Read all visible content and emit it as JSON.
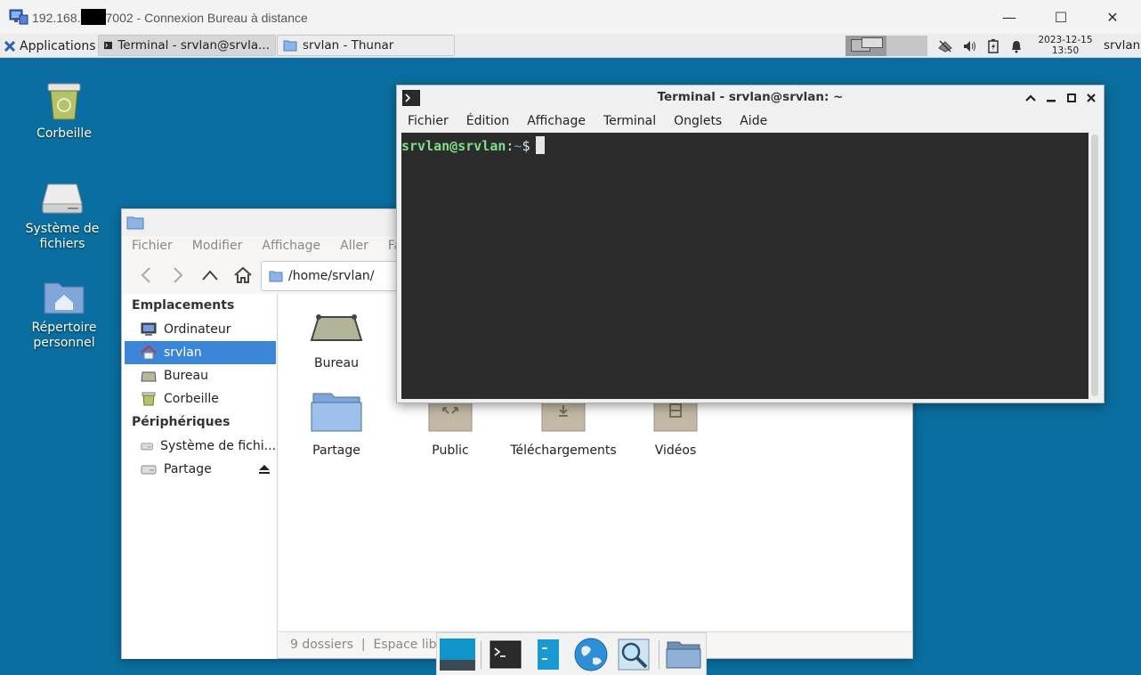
{
  "rdp": {
    "title_prefix": "192.168.",
    "title_suffix": "7002 - Connexion Bureau à distance",
    "minimize": "—",
    "maximize": "☐",
    "close": "✕"
  },
  "panel": {
    "applications": "Applications",
    "tasks": [
      {
        "label": "Terminal - srvlan@srvla...",
        "active": true
      },
      {
        "label": "srvlan - Thunar",
        "active": false
      }
    ],
    "clock_date": "2023-12-15",
    "clock_time": "13:50",
    "user": "srvlan"
  },
  "desktop": {
    "icons": [
      {
        "label": "Corbeille"
      },
      {
        "label": "Système de fichiers"
      },
      {
        "label": "Répertoire personnel"
      }
    ]
  },
  "thunar": {
    "menu": [
      "Fichier",
      "Modifier",
      "Affichage",
      "Aller",
      "Favoris"
    ],
    "path": "/home/srvlan/",
    "sidebar": {
      "places_header": "Emplacements",
      "places": [
        "Ordinateur",
        "srvlan",
        "Bureau",
        "Corbeille"
      ],
      "selected": "srvlan",
      "devices_header": "Périphériques",
      "devices": [
        "Système de fichi...",
        "Partage"
      ]
    },
    "files": [
      "Bureau",
      "Partage",
      "Public",
      "Téléchargements",
      "Vidéos"
    ],
    "status": "9 dossiers  |  Espace libre"
  },
  "terminal": {
    "title": "Terminal - srvlan@srvlan: ~",
    "menu": [
      "Fichier",
      "Édition",
      "Affichage",
      "Terminal",
      "Onglets",
      "Aide"
    ],
    "prompt_user": "srvlan@srvlan",
    "prompt_sep": ":",
    "prompt_path": "~",
    "prompt_symbol": "$"
  },
  "dock": {
    "items": [
      "show-desktop-icon",
      "terminal-icon",
      "file-manager-icon",
      "web-browser-icon",
      "app-finder-icon",
      "folder-icon"
    ]
  }
}
